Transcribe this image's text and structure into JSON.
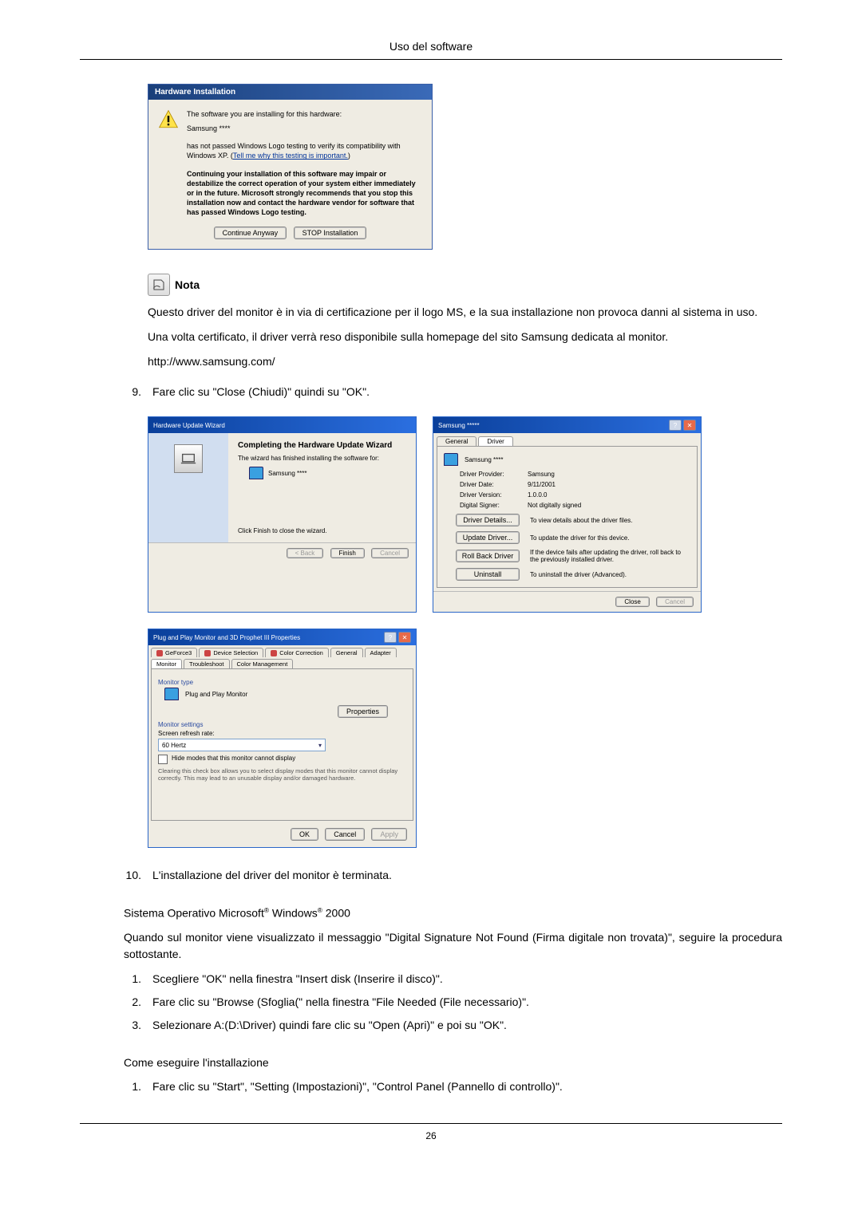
{
  "header": {
    "title": "Uso del software"
  },
  "hw_install": {
    "title": "Hardware Installation",
    "line1": "The software you are installing for this hardware:",
    "device": "Samsung ****",
    "line2a": "has not passed Windows Logo testing to verify its compatibility with Windows XP. (",
    "line2_link": "Tell me why this testing is important.",
    "line2b": ")",
    "warn": "Continuing your installation of this software may impair or destabilize the correct operation of your system either immediately or in the future. Microsoft strongly recommends that you stop this installation now and contact the hardware vendor for software that has passed Windows Logo testing.",
    "btn_continue": "Continue Anyway",
    "btn_stop": "STOP Installation"
  },
  "nota": {
    "label": "Nota",
    "p1": "Questo driver del monitor è in via di certificazione per il logo MS, e la sua installazione non provoca danni al sistema in uso.",
    "p2": "Una volta certificato, il driver verrà reso disponibile sulla homepage del sito Samsung dedicata al monitor.",
    "url": "http://www.samsung.com/"
  },
  "step9": {
    "num": "9.",
    "text": "Fare clic su \"Close (Chiudi)\" quindi su \"OK\"."
  },
  "wizard": {
    "title": "Hardware Update Wizard",
    "heading": "Completing the Hardware Update Wizard",
    "line1": "The wizard has finished installing the software for:",
    "device": "Samsung ****",
    "line2": "Click Finish to close the wizard.",
    "btn_back": "< Back",
    "btn_finish": "Finish",
    "btn_cancel": "Cancel"
  },
  "driver": {
    "title": "Samsung *****",
    "tab_general": "General",
    "tab_driver": "Driver",
    "device": "Samsung ****",
    "rows": {
      "provider_l": "Driver Provider:",
      "provider_v": "Samsung",
      "date_l": "Driver Date:",
      "date_v": "9/11/2001",
      "version_l": "Driver Version:",
      "version_v": "1.0.0.0",
      "signer_l": "Digital Signer:",
      "signer_v": "Not digitally signed"
    },
    "btns": {
      "details": "Driver Details...",
      "details_d": "To view details about the driver files.",
      "update": "Update Driver...",
      "update_d": "To update the driver for this device.",
      "rollback": "Roll Back Driver",
      "rollback_d": "If the device fails after updating the driver, roll back to the previously installed driver.",
      "uninstall": "Uninstall",
      "uninstall_d": "To uninstall the driver (Advanced)."
    },
    "btn_close": "Close",
    "btn_cancel": "Cancel"
  },
  "mon": {
    "title": "Plug and Play Monitor and 3D Prophet III Properties",
    "tabs": {
      "geforce": "GeForce3",
      "devsel": "Device Selection",
      "colorcorr": "Color Correction",
      "general": "General",
      "adapter": "Adapter",
      "monitor": "Monitor",
      "trouble": "Troubleshoot",
      "colormgmt": "Color Management"
    },
    "group_type": "Monitor type",
    "type_value": "Plug and Play Monitor",
    "btn_props": "Properties",
    "group_settings": "Monitor settings",
    "refresh_label": "Screen refresh rate:",
    "refresh_value": "60 Hertz",
    "hide_label": "Hide modes that this monitor cannot display",
    "hide_desc": "Clearing this check box allows you to select display modes that this monitor cannot display correctly. This may lead to an unusable display and/or damaged hardware.",
    "btn_ok": "OK",
    "btn_cancel": "Cancel",
    "btn_apply": "Apply"
  },
  "step10": {
    "num": "10.",
    "text": "L'installazione del driver del monitor è terminata."
  },
  "os2000": {
    "pre": "Sistema Operativo Microsoft",
    "mid": " Windows",
    "post": " 2000"
  },
  "dsnf": "Quando sul monitor viene visualizzato il messaggio \"Digital Signature Not Found (Firma digitale non trovata)\", seguire la procedura sottostante.",
  "dsnf_steps": {
    "s1n": "1.",
    "s1": "Scegliere \"OK\" nella finestra \"Insert disk (Inserire il disco)\".",
    "s2n": "2.",
    "s2": "Fare clic su \"Browse (Sfoglia(\" nella finestra \"File Needed (File necessario)\".",
    "s3n": "3.",
    "s3": "Selezionare A:(D:\\Driver) quindi fare clic su \"Open (Apri)\" e poi su \"OK\"."
  },
  "install_head": "Come eseguire l'installazione",
  "install_steps": {
    "s1n": "1.",
    "s1": "Fare clic su \"Start\", \"Setting (Impostazioni)\", \"Control Panel (Pannello di controllo)\"."
  },
  "page_number": "26"
}
